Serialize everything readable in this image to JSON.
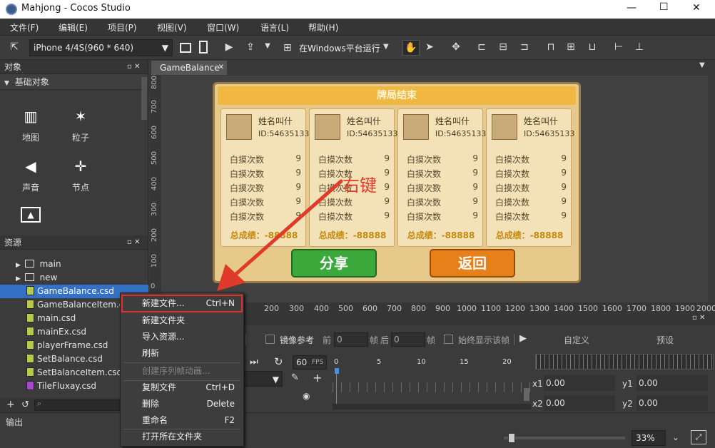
{
  "window": {
    "title": "Mahjong - Cocos Studio",
    "min": "—",
    "max": "☐",
    "close": "✕"
  },
  "menu": [
    "文件(F)",
    "编辑(E)",
    "项目(P)",
    "视图(V)",
    "窗口(W)",
    "语言(L)",
    "帮助(H)"
  ],
  "toolbar": {
    "device": "iPhone 4/4S(960 * 640)",
    "run_target": "在Windows平台运行"
  },
  "objects_panel": {
    "title": "对象",
    "section": "基础对象",
    "items": [
      "地图",
      "粒子",
      "声音",
      "节点"
    ]
  },
  "resources_panel": {
    "title": "资源",
    "folders": [
      "main",
      "new"
    ],
    "files": [
      "GameBalance.csd",
      "GameBalanceItem.csd",
      "main.csd",
      "mainEx.csd",
      "playerFrame.csd",
      "SetBalance.csd",
      "SetBalanceItem.csd",
      "TileFluxay.csd"
    ]
  },
  "output_label": "输出",
  "editor": {
    "tab": "GameBalance",
    "tab_close": "✕",
    "vticks": [
      "800",
      "700",
      "600",
      "500",
      "400",
      "300",
      "200",
      "100",
      "0"
    ],
    "hticks": [
      "200",
      "300",
      "400",
      "500",
      "600",
      "700",
      "800",
      "900",
      "1000",
      "1100",
      "1200",
      "1300",
      "1400",
      "1500",
      "1600",
      "1700",
      "1800",
      "1900",
      "2000"
    ]
  },
  "dialog": {
    "title": "牌局结束",
    "share": "分享",
    "back": "返回",
    "player_name": "姓名叫什",
    "player_id": "ID:54635133",
    "rows": [
      [
        "白摸次数",
        "9"
      ],
      [
        "白摸次数",
        "9"
      ],
      [
        "白摸次数",
        "9"
      ],
      [
        "白摸次数",
        "9"
      ],
      [
        "白摸次数",
        "9"
      ]
    ],
    "total": "总成绩：-88888"
  },
  "annotation": "右键",
  "timeline": {
    "mirror_label": "镜像参考",
    "front_label": "前",
    "front_value": "0",
    "frame_unit": "帧",
    "back_label": "后",
    "back_value": "0",
    "always_show": "始终显示该帧",
    "fps_value": "60",
    "fps_unit": "FPS",
    "ticks": [
      "0",
      "5",
      "10",
      "15",
      "20"
    ],
    "custom_tab": "自定义",
    "preset_tab": "预设",
    "x1": "x1",
    "x1_val": "0.00",
    "y1": "y1",
    "y1_val": "0.00",
    "x2": "x2",
    "x2_val": "0.00",
    "y2": "y2",
    "y2_val": "0.00"
  },
  "zoom": "33%",
  "context_menu": [
    {
      "label": "新建文件...",
      "shortcut": "Ctrl+N"
    },
    {
      "label": "新建文件夹",
      "shortcut": ""
    },
    {
      "label": "导入资源...",
      "shortcut": ""
    },
    {
      "label": "刷新",
      "shortcut": ""
    },
    {
      "label": "创建序列帧动画...",
      "shortcut": ""
    },
    {
      "label": "复制文件",
      "shortcut": "Ctrl+D"
    },
    {
      "label": "删除",
      "shortcut": "Delete"
    },
    {
      "label": "重命名",
      "shortcut": "F2"
    },
    {
      "label": "打开所在文件夹",
      "shortcut": ""
    }
  ],
  "colors": {
    "selection": "#3470c4",
    "highlight_border": "#e0302a",
    "arrow": "#e03a2a"
  }
}
